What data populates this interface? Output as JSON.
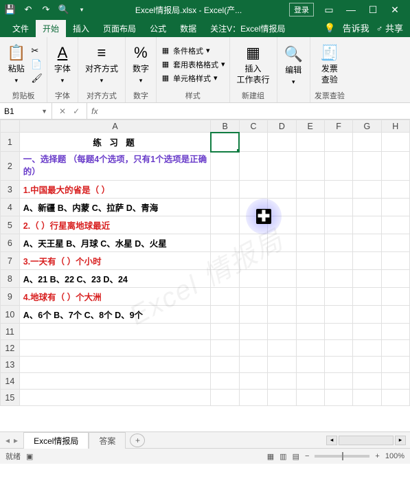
{
  "titlebar": {
    "filename": "Excel情报局.xlsx",
    "appname": "Excel(产...",
    "login": "登录"
  },
  "tabs": {
    "file": "文件",
    "home": "开始",
    "insert": "插入",
    "layout": "页面布局",
    "formulas": "公式",
    "data": "数据",
    "follow": "关注V：Excel情报局",
    "tellme": "告诉我",
    "share": "共享"
  },
  "ribbon": {
    "clipboard": {
      "paste": "粘贴",
      "label": "剪贴板"
    },
    "font": {
      "btn": "字体",
      "label": "字体"
    },
    "align": {
      "btn": "对齐方式",
      "label": "对齐方式"
    },
    "number": {
      "btn": "数字",
      "label": "数字"
    },
    "styles": {
      "cond": "条件格式",
      "table": "套用表格格式",
      "cell": "单元格样式",
      "label": "样式"
    },
    "insert": {
      "btn": "插入",
      "ws": "工作表行",
      "label": "新建组"
    },
    "edit": {
      "btn": "编辑",
      "label": ""
    },
    "invoice": {
      "btn": "发票",
      "sub": "查验",
      "label": "发票查验"
    }
  },
  "namebox": "B1",
  "fx": "fx",
  "columns": [
    "A",
    "B",
    "C",
    "D",
    "E",
    "F",
    "G",
    "H"
  ],
  "rows": {
    "r1": {
      "text": "练 习 题",
      "cls": "title-cell"
    },
    "r2": {
      "text": "一、选择题\n（每题4个选项，只有1个选项是正确的）",
      "cls": "section"
    },
    "r3": {
      "text": "1.中国最大的省是（  ）",
      "cls": "red"
    },
    "r4": {
      "text": "A、新疆  B、内蒙 C、拉萨  D、青海",
      "cls": "black"
    },
    "r5": {
      "text": "2.（  ）行星离地球最近",
      "cls": "red"
    },
    "r6": {
      "text": "A、天王星  B、月球 C、水星  D、火星",
      "cls": "black"
    },
    "r7": {
      "text": "3.一天有（ ）个小时",
      "cls": "red"
    },
    "r8": {
      "text": "A、21  B、22 C、23  D、24",
      "cls": "black"
    },
    "r9": {
      "text": "4.地球有（  ）个大洲",
      "cls": "red"
    },
    "r10": {
      "text": "A、6个  B、7个 C、8个  D、9个",
      "cls": "black"
    }
  },
  "sheets": {
    "active": "Excel情报局",
    "other": "答案"
  },
  "statusbar": {
    "ready": "就绪",
    "zoom": "100%"
  },
  "watermark": "Excel 情报局"
}
